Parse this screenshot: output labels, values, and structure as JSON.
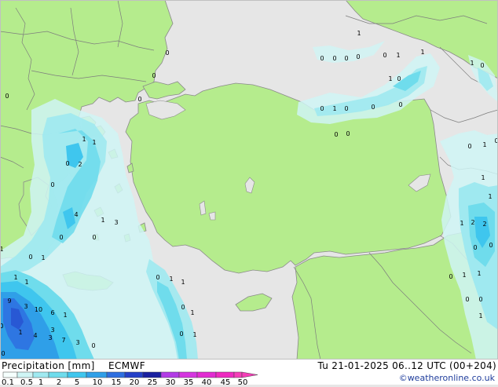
{
  "footer": {
    "title": "Precipitation [mm]",
    "model": "ECMWF",
    "datetime": "Tu 21-01-2025 06..12 UTC (00+204)",
    "credit": "©weatheronline.co.uk"
  },
  "legend": {
    "ticks": [
      "0.1",
      "0.5",
      "1",
      "2",
      "5",
      "10",
      "15",
      "20",
      "25",
      "30",
      "35",
      "40",
      "45",
      "50"
    ],
    "colors": [
      "#f5fffd",
      "#cff5f5",
      "#9fe9f0",
      "#6fdcec",
      "#3fc6ee",
      "#2f9fe8",
      "#2e6fe0",
      "#2540c8",
      "#1a20a0",
      "#b23ce6",
      "#d536e0",
      "#e22cd2",
      "#ee2ac0",
      "#f53eb8"
    ]
  },
  "colors": {
    "sea": "#e6e6e6",
    "land": "#b5ec8d",
    "border": "#7d7d7d"
  },
  "map_labels": [
    {
      "text": "1"
    },
    {
      "text": "0"
    },
    {
      "text": "0"
    },
    {
      "text": "0"
    },
    {
      "text": "0"
    },
    {
      "text": "0"
    },
    {
      "text": "1"
    },
    {
      "text": "0"
    },
    {
      "text": "1"
    },
    {
      "text": "1"
    },
    {
      "text": "0"
    },
    {
      "text": "0"
    },
    {
      "text": "0"
    },
    {
      "text": "0"
    },
    {
      "text": "1"
    },
    {
      "text": "0"
    },
    {
      "text": "0"
    },
    {
      "text": "0"
    },
    {
      "text": "0"
    },
    {
      "text": "0"
    },
    {
      "text": "2"
    },
    {
      "text": "0"
    },
    {
      "text": "1"
    },
    {
      "text": "1"
    },
    {
      "text": "1"
    },
    {
      "text": "0"
    },
    {
      "text": "1"
    },
    {
      "text": "2"
    },
    {
      "text": "0"
    },
    {
      "text": "4"
    },
    {
      "text": "1"
    },
    {
      "text": "3"
    },
    {
      "text": "0"
    },
    {
      "text": "0"
    },
    {
      "text": "1"
    },
    {
      "text": "0"
    },
    {
      "text": "0"
    },
    {
      "text": "1"
    },
    {
      "text": "1"
    },
    {
      "text": "1"
    },
    {
      "text": "1"
    },
    {
      "text": "9"
    },
    {
      "text": "3"
    },
    {
      "text": "10"
    },
    {
      "text": "6"
    },
    {
      "text": "3"
    },
    {
      "text": "1"
    },
    {
      "text": "4"
    },
    {
      "text": "3"
    },
    {
      "text": "7"
    },
    {
      "text": "3"
    },
    {
      "text": "0"
    },
    {
      "text": "0"
    },
    {
      "text": "1"
    },
    {
      "text": "0"
    },
    {
      "text": "1"
    },
    {
      "text": "0"
    },
    {
      "text": "1"
    },
    {
      "text": "0"
    },
    {
      "text": "0"
    },
    {
      "text": "1"
    },
    {
      "text": "0"
    },
    {
      "text": "1"
    },
    {
      "text": "1"
    },
    {
      "text": "2"
    },
    {
      "text": "1"
    },
    {
      "text": "1"
    },
    {
      "text": "0"
    },
    {
      "text": "0"
    },
    {
      "text": "0"
    },
    {
      "text": "0"
    },
    {
      "text": "1"
    },
    {
      "text": "0"
    },
    {
      "text": "0"
    },
    {
      "text": "1"
    }
  ]
}
